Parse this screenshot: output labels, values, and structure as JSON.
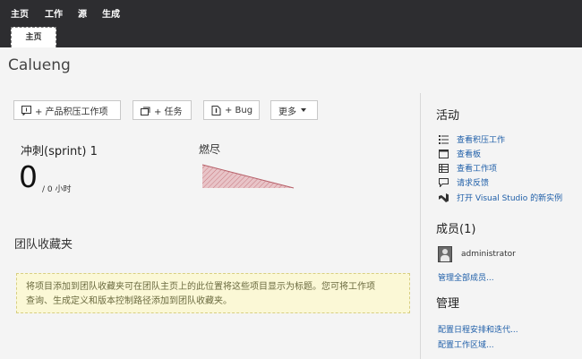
{
  "nav": {
    "items": [
      "主页",
      "工作",
      "源",
      "生成"
    ],
    "active_tab": "主页"
  },
  "project": {
    "title": "Calueng"
  },
  "toolbar": {
    "backlog_label": "+ 产品积压工作项",
    "task_label": "+ 任务",
    "bug_label": "+ Bug",
    "more_label": "更多"
  },
  "sprint": {
    "name": "冲刺(sprint) 1",
    "count": "0",
    "hours": "/ 0 小时"
  },
  "burndown": {
    "label": "燃尽"
  },
  "favorites": {
    "title": "团队收藏夹",
    "message_line1": "将项目添加到团队收藏夹可在团队主页上的此位置将这些项目显示为标题。您可将工作项",
    "message_line2": "查询、生成定义和版本控制路径添加到团队收藏夹。"
  },
  "activity": {
    "title": "活动",
    "links": [
      {
        "label": "查看积压工作",
        "icon": "backlog-list-icon"
      },
      {
        "label": "查看板",
        "icon": "board-icon"
      },
      {
        "label": "查看工作项",
        "icon": "work-items-icon"
      },
      {
        "label": "请求反馈",
        "icon": "feedback-icon"
      },
      {
        "label": "打开 Visual Studio 的新实例",
        "icon": "visual-studio-icon"
      }
    ]
  },
  "members": {
    "title": "成员(1)",
    "list": [
      {
        "name": "administrator"
      }
    ],
    "manage_label": "管理全部成员..."
  },
  "admin": {
    "title": "管理",
    "links": [
      "配置日程安排和迭代...",
      "配置工作区域..."
    ]
  },
  "colors": {
    "topbar": "#2d2d30",
    "link": "#1e5ea8",
    "burndown_fill": "#e8c4c8",
    "burndown_hatch": "#c9797f",
    "favorites_bg": "#fbf8d6"
  }
}
